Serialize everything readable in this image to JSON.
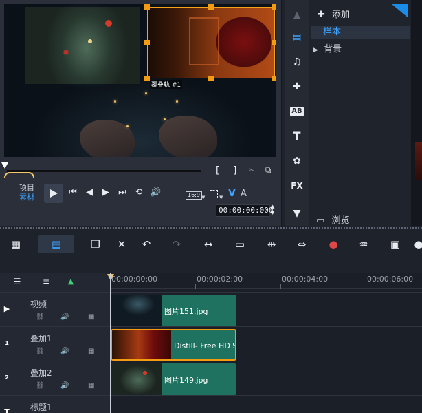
{
  "preview": {
    "overlay_label": "覆叠轨 #1",
    "mark_in": "[",
    "mark_out": "]",
    "mode_project": "项目",
    "mode_clip": "素材",
    "aspect": "16:9",
    "video_toggle": "V",
    "audio_toggle": "A",
    "timecode": "00:00:00:000"
  },
  "library": {
    "add_label": "添加",
    "items": [
      "样本",
      "背景"
    ],
    "browse_label": "浏览",
    "category_labels": [
      "AB",
      "T",
      "FX"
    ]
  },
  "timeline": {
    "ruler_labels": [
      "00:00:00:00",
      "00:00:02:00",
      "00:00:04:00",
      "00:00:06:00"
    ],
    "tracks": [
      {
        "name": "视频",
        "clip": "图片151.jpg"
      },
      {
        "name": "叠加1",
        "clip": "Distill- Free HD S"
      },
      {
        "name": "叠加2",
        "clip": "图片149.jpg"
      },
      {
        "name": "标题1"
      }
    ]
  },
  "colors": {
    "accent": "#3ea3ff",
    "selection": "#f39c12",
    "clip": "#1f7260",
    "background": "#1e222b"
  }
}
